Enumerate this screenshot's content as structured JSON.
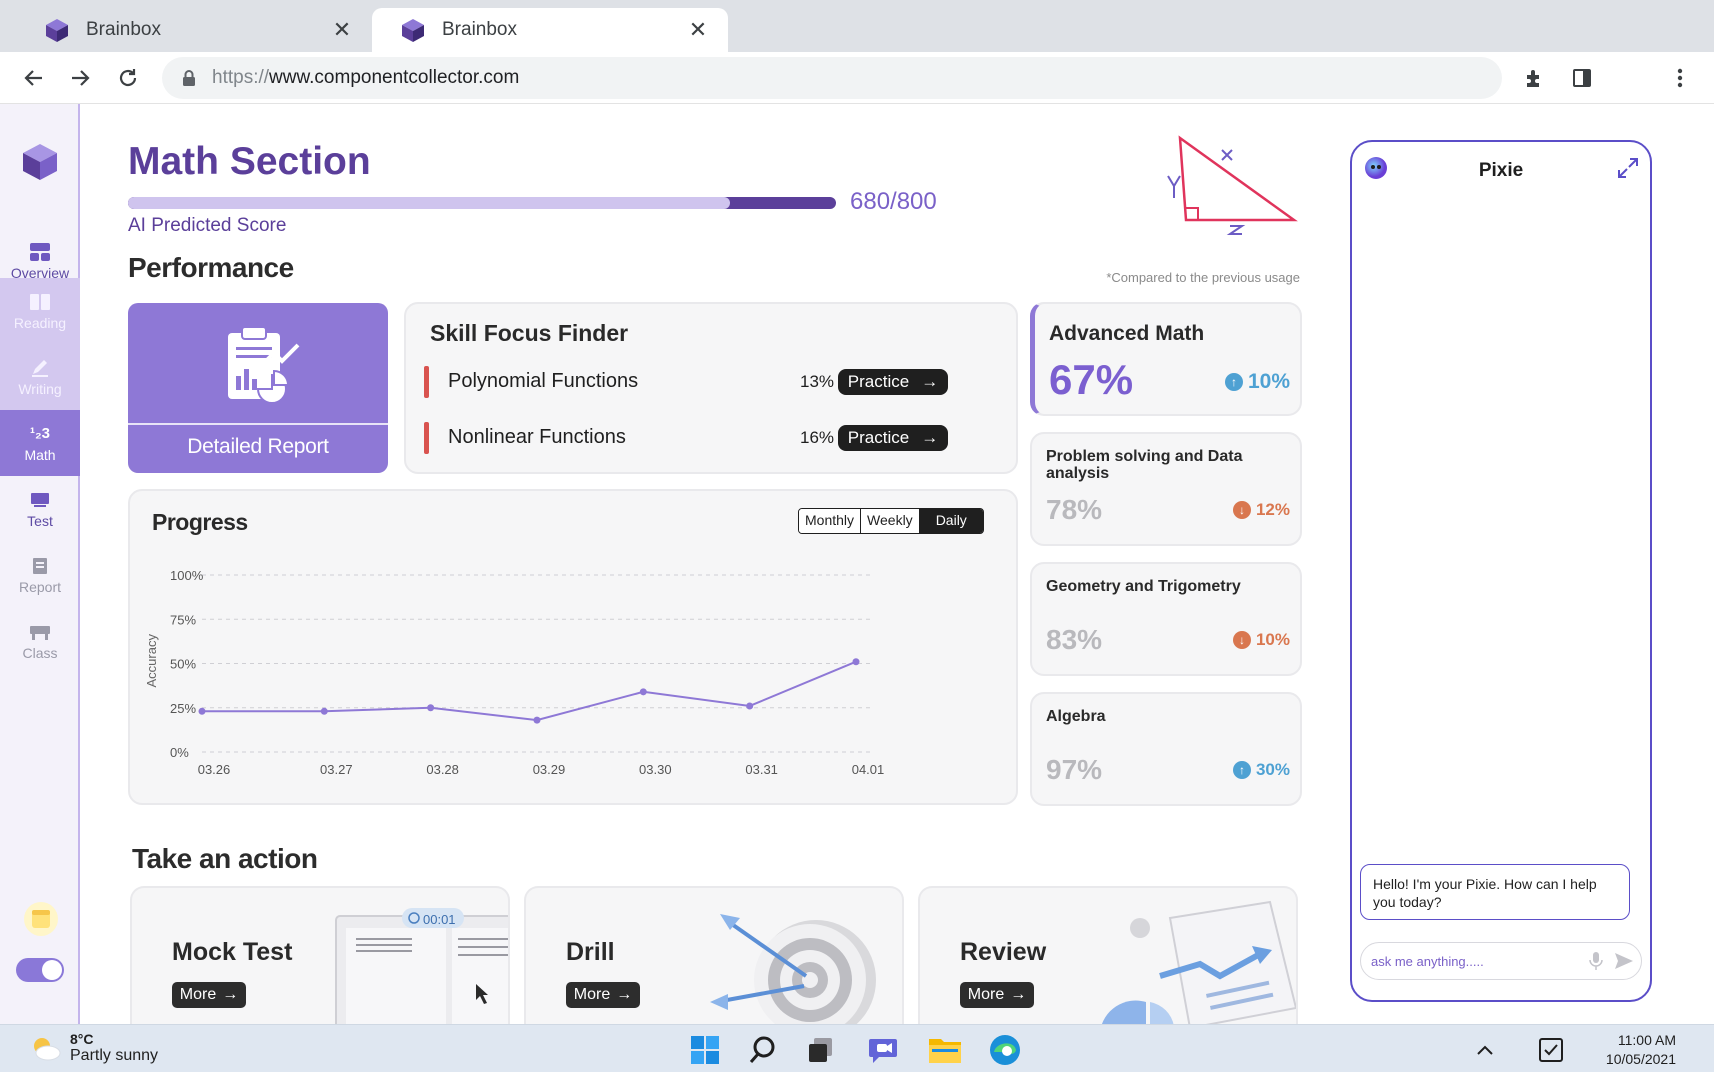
{
  "browser": {
    "tabs": [
      {
        "title": "Brainbox",
        "active": false
      },
      {
        "title": "Brainbox",
        "active": true
      }
    ],
    "url_scheme": "https://",
    "url_host": "www.componentcollector.com"
  },
  "sidebar": {
    "items": [
      {
        "label": "Overview",
        "icon": "grid-icon",
        "state": "plain"
      },
      {
        "label": "Reading",
        "icon": "book-icon",
        "state": "tinted"
      },
      {
        "label": "Writing",
        "icon": "pencil-icon",
        "state": "tinted"
      },
      {
        "label": "Math",
        "icon": "math-icon",
        "state": "active"
      },
      {
        "label": "Test",
        "icon": "test-icon",
        "state": "plain"
      },
      {
        "label": "Report",
        "icon": "report-icon",
        "state": "grey"
      },
      {
        "label": "Class",
        "icon": "class-icon",
        "state": "grey"
      }
    ]
  },
  "header": {
    "title": "Math Section",
    "score_text": "680/800",
    "score_fraction": 0.85,
    "score_label": "AI Predicted Score"
  },
  "performance": {
    "title": "Performance",
    "note": "*Compared to the previous usage",
    "report_label": "Detailed Report"
  },
  "skill_focus": {
    "title": "Skill Focus Finder",
    "items": [
      {
        "name": "Polynomial Functions",
        "pct": "13%",
        "action": "Practice"
      },
      {
        "name": "Nonlinear Functions",
        "pct": "16%",
        "action": "Practice"
      }
    ]
  },
  "progress": {
    "title": "Progress",
    "periods": [
      "Monthly",
      "Weekly",
      "Daily"
    ],
    "selected_period": "Daily"
  },
  "chart_data": {
    "type": "line",
    "title": "",
    "ylabel": "Accuracy",
    "x": [
      "03.26",
      "03.27",
      "03.28",
      "03.29",
      "03.30",
      "03.31",
      "04.01"
    ],
    "x_positions": [
      0,
      1.15,
      2.15,
      3.15,
      4.15,
      5.15,
      6.15
    ],
    "series": [
      {
        "values": [
          23,
          23,
          25,
          18,
          34,
          26,
          51
        ]
      }
    ],
    "ylim": [
      0,
      100
    ],
    "yticks": [
      "0%",
      "25%",
      "50%",
      "75%",
      "100%"
    ],
    "grid": true,
    "color": "#8e78d6"
  },
  "stats": [
    {
      "name": "Advanced Math",
      "value": "67%",
      "change": "10%",
      "direction": "up"
    },
    {
      "name": "Problem solving and Data analysis",
      "value": "78%",
      "change": "12%",
      "direction": "down"
    },
    {
      "name": "Geometry and Trigometry",
      "value": "83%",
      "change": "10%",
      "direction": "down"
    },
    {
      "name": "Algebra",
      "value": "97%",
      "change": "30%",
      "direction": "up"
    }
  ],
  "actions": {
    "title": "Take an action",
    "cards": [
      {
        "title": "Mock Test",
        "button": "More",
        "timer": "00:01"
      },
      {
        "title": "Drill",
        "button": "More"
      },
      {
        "title": "Review",
        "button": "More"
      }
    ]
  },
  "pixie": {
    "title": "Pixie",
    "greeting": "Hello! I'm your Pixie. How can I help you today?",
    "placeholder": "ask me anything....."
  },
  "taskbar": {
    "temp": "8°C",
    "weather": "Partly sunny",
    "time": "11:00 AM",
    "date": "10/05/2021"
  },
  "colors": {
    "brand": "#5b3f9a",
    "accent": "#8e78d6",
    "up": "#4ea1d3",
    "down": "#d9774f"
  }
}
